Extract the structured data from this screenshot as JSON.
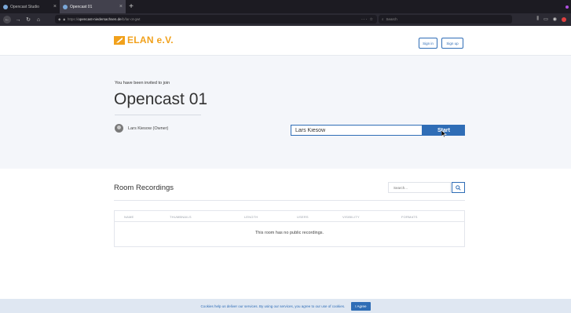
{
  "browser": {
    "tabs": [
      {
        "label": "Opencast Studio"
      },
      {
        "label": "Opencast 01"
      }
    ],
    "new_tab": "+",
    "url_protocol": "https://",
    "url_host": "opencast-niedersachsen.de",
    "url_path": "/b/lar-ot-gwt",
    "search_placeholder": "Search"
  },
  "header": {
    "logo_text": "ELAN e.V.",
    "sign_in": "Sign in",
    "sign_up": "Sign up",
    "brand_color": "#f1a11c",
    "accent_color": "#2f6db6"
  },
  "invite": {
    "label": "You have been invited to join",
    "room_name": "Opencast 01",
    "owner": "Lars Kiesow (Owner)",
    "name_value": "Lars Kiesow",
    "start_label": "Start"
  },
  "recordings": {
    "title": "Room Recordings",
    "search_placeholder": "Search...",
    "columns": [
      "NAME",
      "THUMBNAILS",
      "LENGTH",
      "USERS",
      "VISIBILITY",
      "FORMATS"
    ],
    "empty_message": "This room has no public recordings."
  },
  "cookie": {
    "message": "Cookies help us deliver our services. By using our services, you agree to our use of cookies.",
    "agree": "I Agree"
  }
}
